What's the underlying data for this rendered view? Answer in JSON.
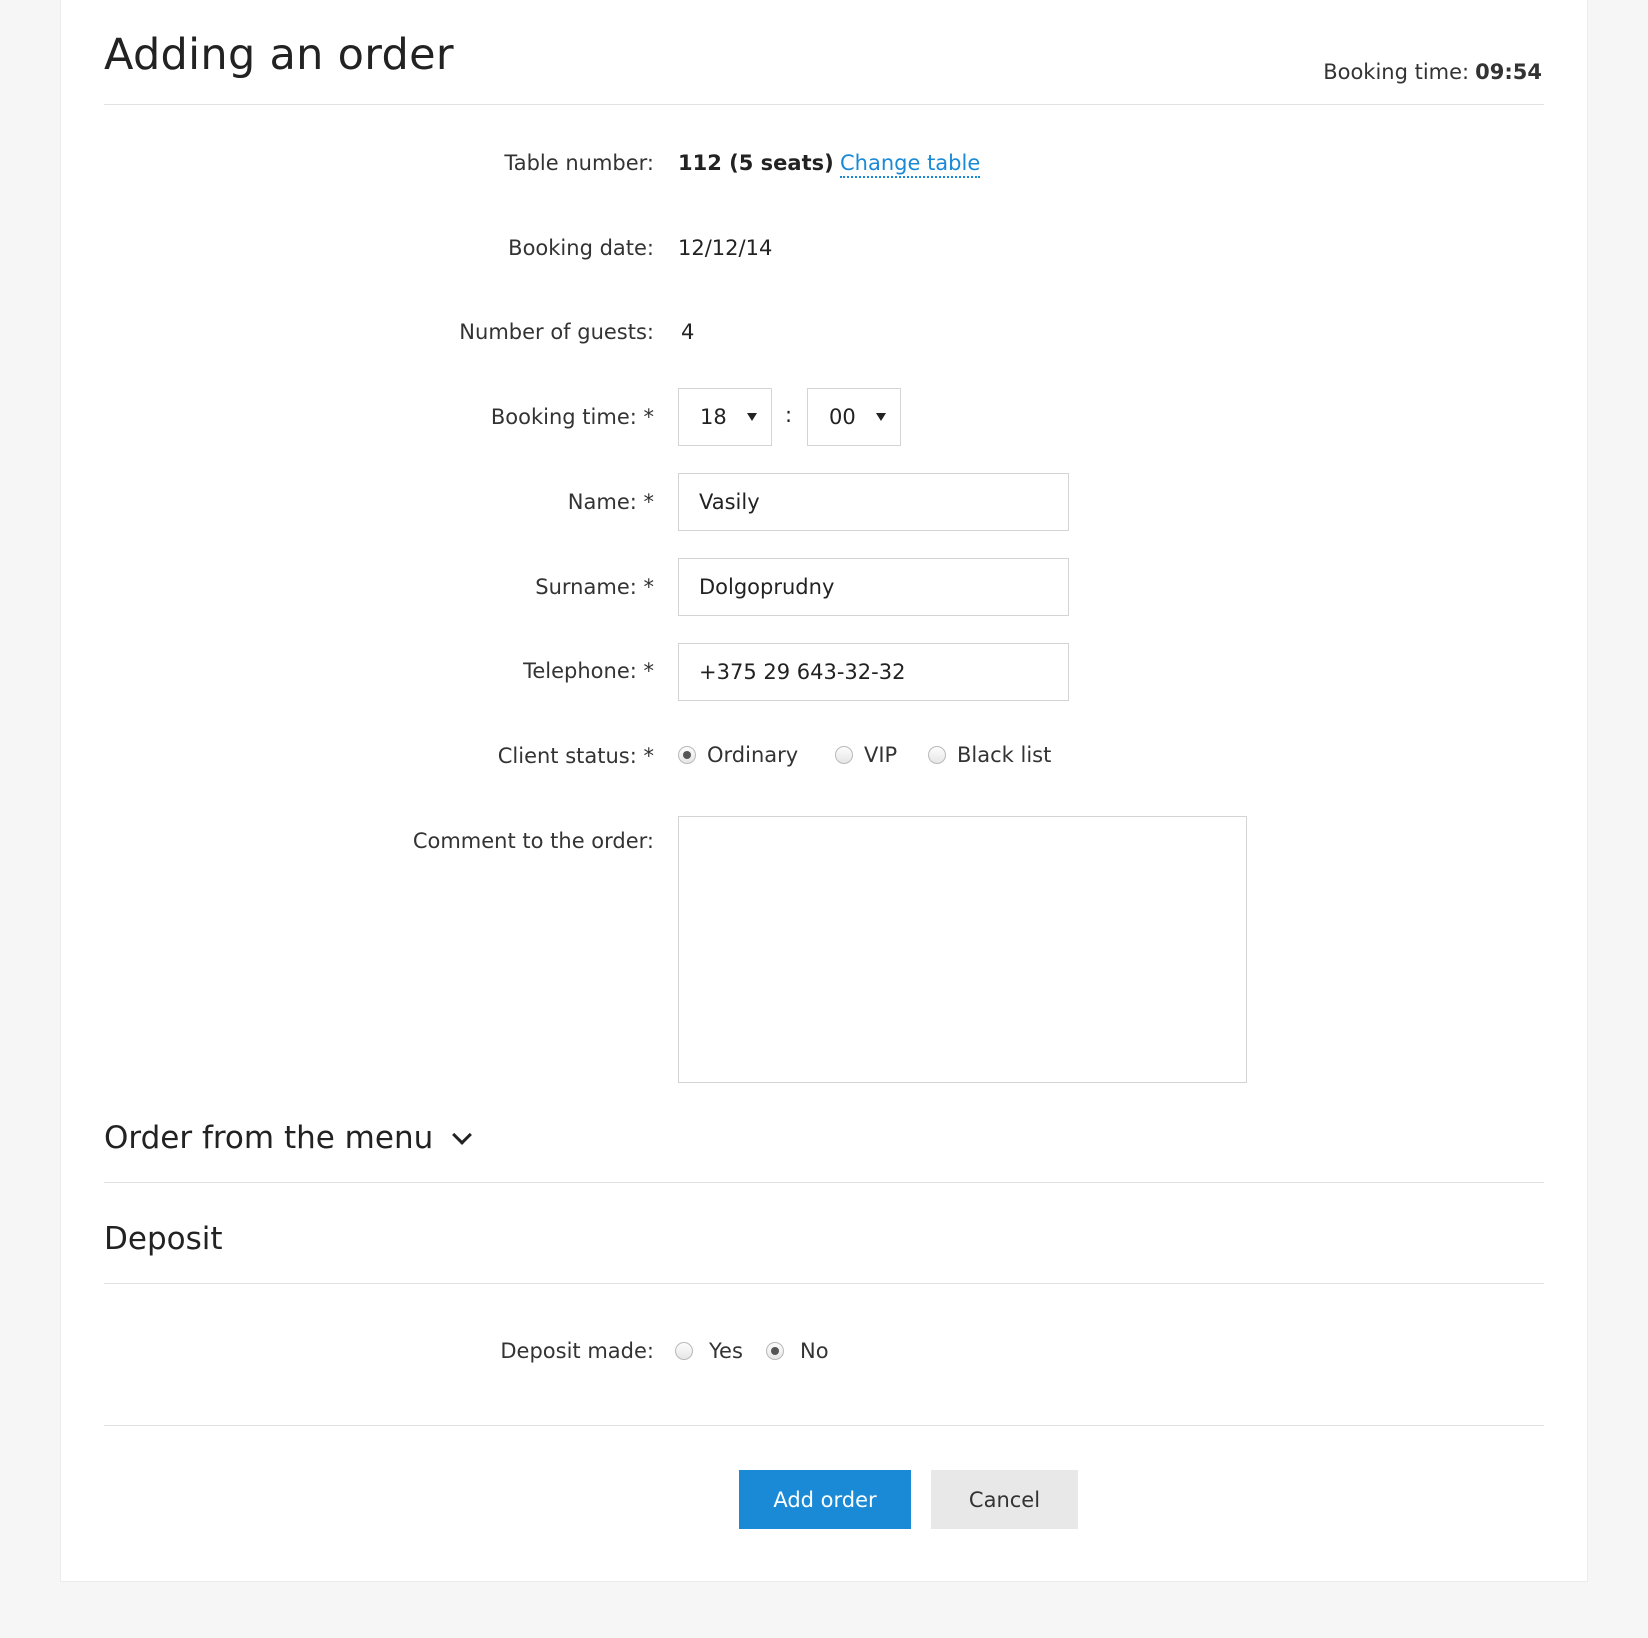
{
  "header": {
    "title": "Adding an order",
    "booking_time_label": "Booking time:",
    "booking_time_value": "09:54"
  },
  "form": {
    "table_number": {
      "label": "Table number:",
      "value": "112 (5 seats)",
      "change_link": "Change table"
    },
    "booking_date": {
      "label": "Booking date:",
      "value": "12/12/14"
    },
    "guests": {
      "label": "Number of guests:",
      "value": "4"
    },
    "booking_time": {
      "label": "Booking time: *",
      "hour": "18",
      "separator": ":",
      "minute": "00"
    },
    "name": {
      "label": "Name: *",
      "value": "Vasily"
    },
    "surname": {
      "label": "Surname: *",
      "value": "Dolgoprudny"
    },
    "telephone": {
      "label": "Telephone: *",
      "value": "+375 29 643-32-32"
    },
    "client_status": {
      "label": "Client status: *",
      "options": [
        "Ordinary",
        "VIP",
        "Black list"
      ],
      "selected": "Ordinary"
    },
    "comment": {
      "label": "Comment to the order:",
      "value": ""
    }
  },
  "sections": {
    "menu_title": "Order from the menu",
    "deposit_title": "Deposit"
  },
  "deposit": {
    "label": "Deposit made:",
    "options": [
      "Yes",
      "No"
    ],
    "selected": "No"
  },
  "actions": {
    "submit_label": "Add order",
    "cancel_label": "Cancel"
  },
  "colors": {
    "accent": "#1a8ad6",
    "background": "#f6f6f6",
    "card": "#ffffff",
    "secondary_button": "#e8e8e8"
  }
}
